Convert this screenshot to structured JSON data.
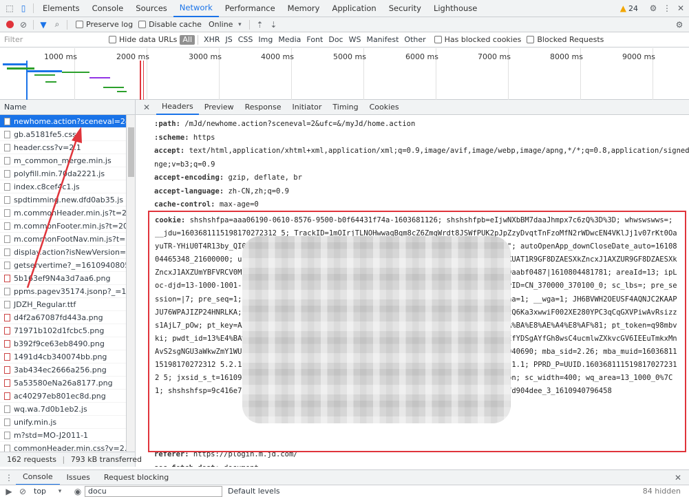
{
  "devtools": {
    "tabs": [
      "Elements",
      "Console",
      "Sources",
      "Network",
      "Performance",
      "Memory",
      "Application",
      "Security",
      "Lighthouse"
    ],
    "warning_count": "24"
  },
  "toolbar": {
    "preserve_log": "Preserve log",
    "disable_cache": "Disable cache",
    "throttle": "Online"
  },
  "filter": {
    "placeholder": "Filter",
    "hide_data_urls": "Hide data URLs",
    "types": [
      "All",
      "XHR",
      "JS",
      "CSS",
      "Img",
      "Media",
      "Font",
      "Doc",
      "WS",
      "Manifest",
      "Other"
    ],
    "has_blocked_cookies": "Has blocked cookies",
    "blocked_requests": "Blocked Requests"
  },
  "overview": {
    "ticks": [
      "1000 ms",
      "2000 ms",
      "3000 ms",
      "4000 ms",
      "5000 ms",
      "6000 ms",
      "7000 ms",
      "8000 ms",
      "9000 ms"
    ]
  },
  "request_list": {
    "header": "Name",
    "items": [
      {
        "name": "newhome.action?sceneval=2&ufc",
        "type": "doc"
      },
      {
        "name": "gb.a5181fe5.css",
        "type": "doc"
      },
      {
        "name": "header.css?v=2.1",
        "type": "doc"
      },
      {
        "name": "m_common_merge.min.js",
        "type": "doc"
      },
      {
        "name": "polyfill.min.70da2221.js",
        "type": "doc"
      },
      {
        "name": "index.c8cef4c1.js",
        "type": "doc"
      },
      {
        "name": "spdtimming.new.dfd0ab35.js",
        "type": "doc"
      },
      {
        "name": "m.commonHeader.min.js?t=2018",
        "type": "doc"
      },
      {
        "name": "m.commonFooter.min.js?t=20200",
        "type": "doc"
      },
      {
        "name": "m.commonFootNav.min.js?t=202",
        "type": "doc"
      },
      {
        "name": "display.action?isNewVersion=1&",
        "type": "doc"
      },
      {
        "name": "getservertime?_=1610940805876",
        "type": "doc"
      },
      {
        "name": "5b163ef9N4a3d7aa6.png",
        "type": "img"
      },
      {
        "name": "ppms.pagev35174.jsonp?_=16109",
        "type": "doc"
      },
      {
        "name": "JDZH_Regular.ttf",
        "type": "doc"
      },
      {
        "name": "d4f2a67087fd443a.png",
        "type": "img"
      },
      {
        "name": "71971b102d1fcbc5.png",
        "type": "img"
      },
      {
        "name": "b392f9ce63eb8490.png",
        "type": "img"
      },
      {
        "name": "1491d4cb340074bb.png",
        "type": "img"
      },
      {
        "name": "3ab434ec2666a256.png",
        "type": "img"
      },
      {
        "name": "5a53580eNa26a8177.png",
        "type": "img"
      },
      {
        "name": "ac40297eb801ec8d.png",
        "type": "img"
      },
      {
        "name": "wq.wa.7d0b1eb2.js",
        "type": "doc"
      },
      {
        "name": "unify.min.js",
        "type": "doc"
      },
      {
        "name": "m?std=MO-J2011-1",
        "type": "doc"
      },
      {
        "name": "commonHeader.min.css?v=2.4.2",
        "type": "doc"
      }
    ],
    "status": "162 requests",
    "transferred": "793 kB transferred"
  },
  "detail": {
    "tabs": [
      "Headers",
      "Preview",
      "Response",
      "Initiator",
      "Timing",
      "Cookies"
    ],
    "headers": [
      {
        "name": ":path:",
        "value": " /mJd/newhome.action?sceneval=2&ufc=&/myJd/home.action"
      },
      {
        "name": ":scheme:",
        "value": " https"
      },
      {
        "name": "accept:",
        "value": " text/html,application/xhtml+xml,application/xml;q=0.9,image/avif,image/webp,image/apng,*/*;q=0.8,application/signed-excha"
      },
      {
        "name": "",
        "value": "nge;v=b3;q=0.9"
      },
      {
        "name": "accept-encoding:",
        "value": " gzip, deflate, br"
      },
      {
        "name": "accept-language:",
        "value": " zh-CN,zh;q=0.9"
      },
      {
        "name": "cache-control:",
        "value": " max-age=0"
      }
    ],
    "cookie_label": "cookie:",
    "cookie_value": " shshshfpa=aaa06190-0610-8576-9500-b0f64431f74a-1603681126; shshshfpb=eIjwNXbBM7daaJhmpx7c6zQ%3D%3D; whwswswws=; __jdu=1603681115198170272312 5; TrackID=1mOIrjTLNOHwwaqBqm8cZ6ZmqWrdt8JSWfPUK2pJpZzyDvqtTnFzoMfN2rWDwcEN4VKlJj1v07rKt0OayuTR-YHiU0T4R13by_QI05anoTkQ; pinId=wq8wzv4tG9f9Lmr2A; warehistory=\"100007673355,\"; autoOpenApp_downCloseDate_auto=1610804465348_21600000; unpl=V2_ZzNtbRFTQh0lCRIlPxBYDB2cLEV1BUnMlRQtGZHopXAJmARVUQldDEXUAT1R9GF8DZAESXkZncxJ1AXZUR9GF8DZAESXkZncxJ1AXZUmYBFVRCV0MRdQBPVH0YXwNkARjeRmdDFHQJR1x5GI1sFZQcixg%3d%3d; __jdv=8ee2b439aabf0487|1610804481781; areaId=13; ipLoc-djd=13-1000-1001-0; mba_sid=16109404482.1610940690.17; __jdc=76161171; PCSYCityID=CN_370000_370100_0; sc_lbs=; pre_session=|7; pre_seq=1; visitkey=12268544058232016; cid=9; webp=1; wxa_level=1; retina=1; __wga=1; JH6BVWH2OEUSF4AQNJC2KAAPJU76WPAJIZP24HNRLKA; jcap_dvzw_fp=EOjBZcLQ; TrackerID=98Mm3TgmW876tIXzlTdFtcZfATUzQ6Ka3xwwiF002XE280YPC3qCqGXVPiwAvRsizzs1AjL7_pOw; pt_key=AAJgBQF5ADCbmaywFQppWBdSjw-nHBrf7hY2wAKvRsizzs1AjL7_pOw; %E4%BA%BA%E8%AE%A4%E8%AF%81; pt_token=q98mbvki; pwdt_id=13%E4%BA%BA; sid=xeDF4MjNCOxwCYgmfPjmRwDCaKmMHoeHhvyKXxSkR8nyV6Ly2GHVIfYDSgAYfGh8wsC4ucmlwZXkvcGV6IEEuTmkxMnAvS2sgNGU3aWkwZmY1WUlGUg%3D%3D; __jdb=76161171.4.1603681115198170272312 5|17.1610940690; mba_sid=2.26; mba_muid=1603681115198170272312 5.2.1610940796077; __wga=1610940796124.1610940796124.1610940796124.1.1; PPRD_P=UUID.1603681115198170272312 5; jxsid_s_t=1610940796180; jxsid_s_u=https%3A//home.m.jd.com/myJd/newhome.action; sc_width=400; wq_area=13_1000_0%7C1; shshshfsp=9c416e794ba35b769d1b03293c53e76c; shshshsID=4f02f5d318936cca5e48bb387d904dee_3_1610940796458",
    "after": [
      {
        "name": "referer:",
        "value": " https://plogin.m.jd.com/"
      },
      {
        "name": "sec-fetch-dest:",
        "value": " document"
      }
    ]
  },
  "console": {
    "tabs": [
      "Console",
      "Issues",
      "Request blocking"
    ],
    "context": "top",
    "filter_value": "docu",
    "levels": "Default levels",
    "hidden": "84 hidden"
  },
  "colors": {
    "accent": "#1a73e8",
    "highlight": "#e0343b"
  }
}
